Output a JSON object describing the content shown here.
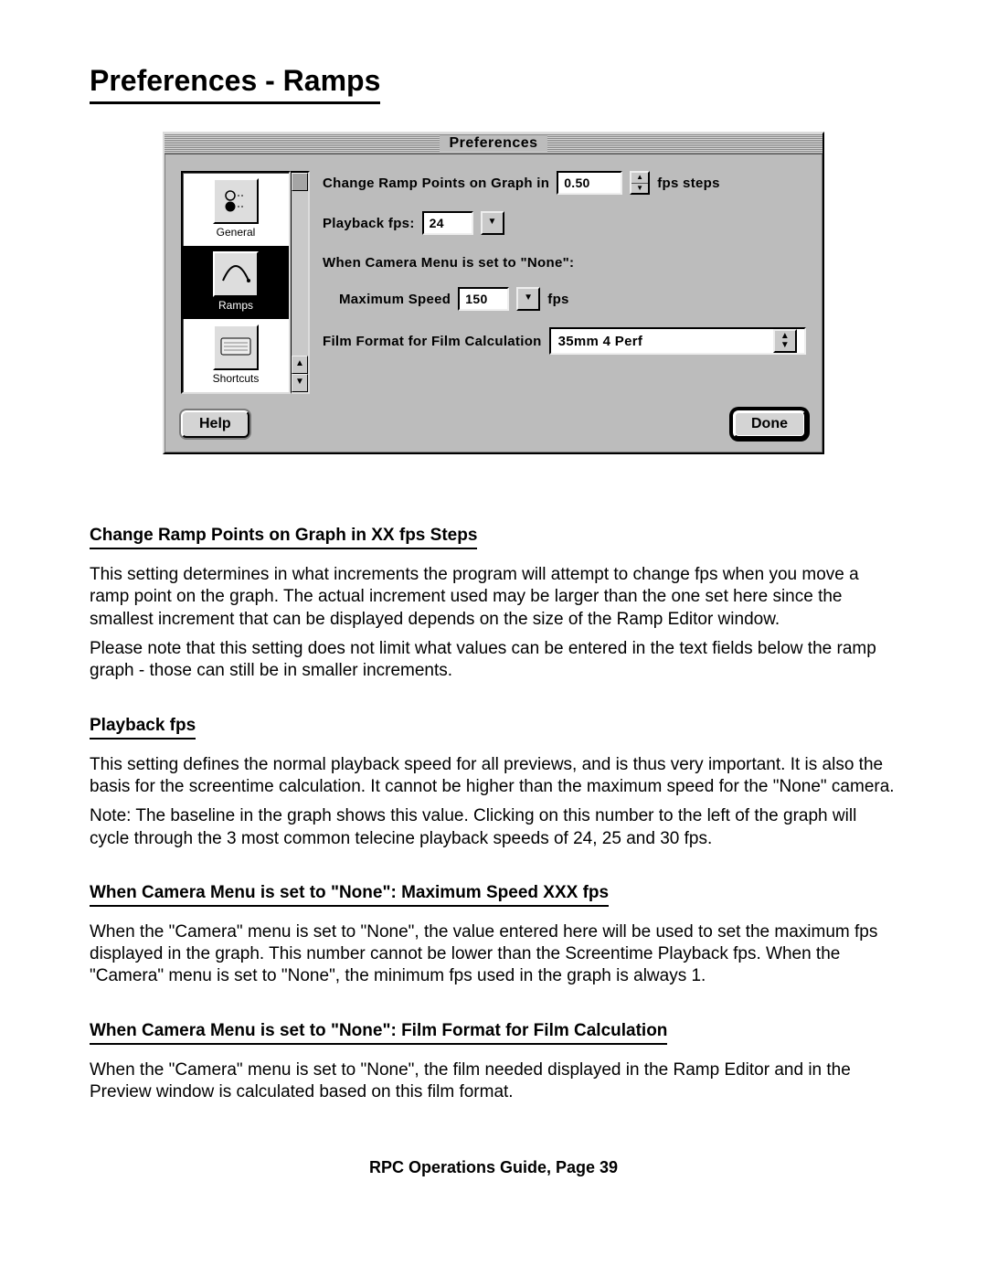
{
  "page_title": "Preferences - Ramps",
  "dialog": {
    "title": "Preferences",
    "sidebar": {
      "items": [
        {
          "label": "General"
        },
        {
          "label": "Ramps"
        },
        {
          "label": "Shortcuts"
        }
      ]
    },
    "form": {
      "ramp_points_label": "Change Ramp Points on Graph in",
      "ramp_points_value": "0.50",
      "ramp_points_suffix": "fps steps",
      "playback_label": "Playback fps:",
      "playback_value": "24",
      "none_heading": "When Camera Menu is set to \"None\":",
      "max_speed_label": "Maximum Speed",
      "max_speed_value": "150",
      "max_speed_suffix": "fps",
      "film_format_label": "Film Format for Film Calculation",
      "film_format_value": "35mm 4 Perf"
    },
    "buttons": {
      "help": "Help",
      "done": "Done"
    }
  },
  "sections": [
    {
      "heading": "Change Ramp Points on Graph in XX fps Steps",
      "paras": [
        "This setting determines in what increments the program will attempt to change fps when you move a ramp point on the graph. The actual increment used may be larger than the one set here since the smallest increment that can be displayed depends on the size of the Ramp Editor window.",
        "Please note that this setting does not limit what values can be entered in the text fields below the ramp graph - those can still be in smaller increments."
      ]
    },
    {
      "heading": "Playback fps",
      "paras": [
        "This setting defines the normal playback speed for all previews, and is thus very important. It is also the basis for the screentime calculation. It cannot be higher than the maximum speed for the \"None\" camera.",
        "Note: The baseline in the graph shows this value. Clicking on this number to the left of the graph will cycle through the 3 most common telecine playback speeds of 24, 25 and 30 fps."
      ]
    },
    {
      "heading": "When Camera Menu is set to \"None\": Maximum Speed XXX fps",
      "paras": [
        "When the \"Camera\" menu is set to \"None\", the value entered here will be used to set the maximum fps displayed in the graph. This number cannot be lower than the Screentime Playback fps. When the \"Camera\" menu is set to \"None\", the minimum fps used in the graph is always 1."
      ]
    },
    {
      "heading": "When Camera Menu is set to \"None\": Film Format for Film Calculation",
      "paras": [
        "When the \"Camera\" menu is set to \"None\", the film needed displayed  in the Ramp Editor and in the Preview window is calculated based on this film format."
      ]
    }
  ],
  "footer": "RPC Operations Guide, Page 39"
}
